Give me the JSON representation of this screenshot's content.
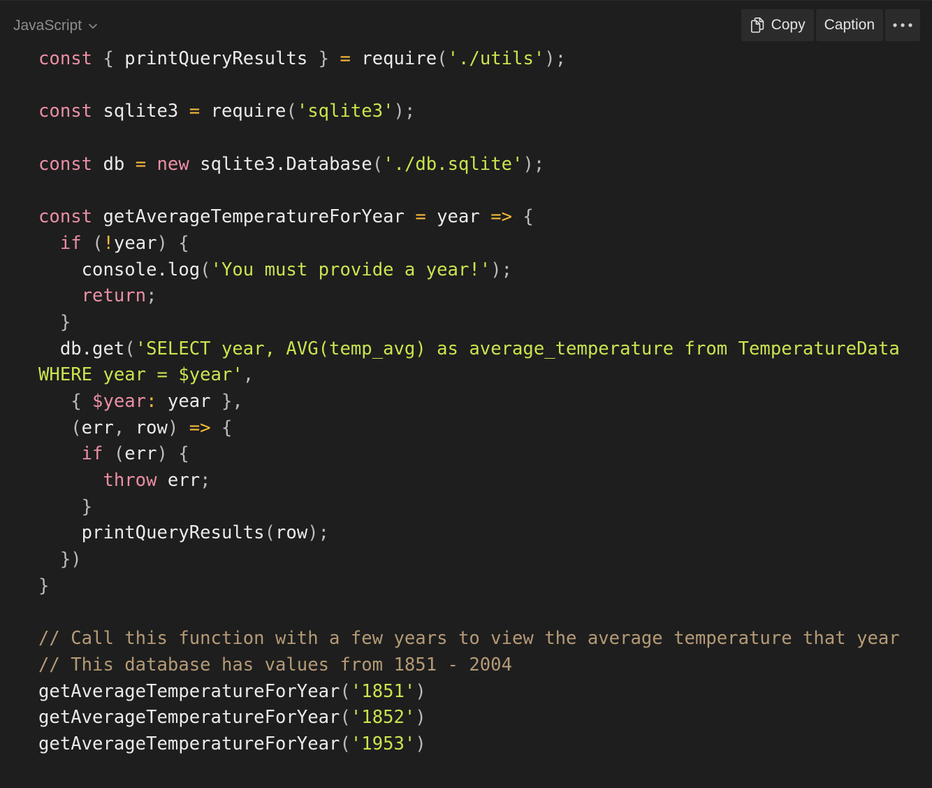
{
  "header": {
    "language": "JavaScript",
    "copy_label": "Copy",
    "caption_label": "Caption"
  },
  "icons": {
    "language_dropdown": "chevron-down-icon",
    "copy": "copy-icon",
    "more": "more-horizontal-icon"
  },
  "colors": {
    "background": "#1e1e1e",
    "keyword": "#ea8fa4",
    "string": "#c9e44f",
    "operator": "#f5b93a",
    "comment": "#b59a76",
    "text": "#eaeaea"
  },
  "code_lines": [
    [
      [
        "kw",
        "const"
      ],
      [
        "pn",
        " { "
      ],
      [
        "tx",
        "printQueryResults"
      ],
      [
        "pn",
        " } "
      ],
      [
        "op",
        "="
      ],
      [
        "tx",
        " require"
      ],
      [
        "pn",
        "("
      ],
      [
        "str",
        "'./utils'"
      ],
      [
        "pn",
        ");"
      ]
    ],
    [],
    [
      [
        "kw",
        "const"
      ],
      [
        "tx",
        " sqlite3 "
      ],
      [
        "op",
        "="
      ],
      [
        "tx",
        " require"
      ],
      [
        "pn",
        "("
      ],
      [
        "str",
        "'sqlite3'"
      ],
      [
        "pn",
        ");"
      ]
    ],
    [],
    [
      [
        "kw",
        "const"
      ],
      [
        "tx",
        " db "
      ],
      [
        "op",
        "="
      ],
      [
        "kw",
        " new"
      ],
      [
        "tx",
        " sqlite3.Database"
      ],
      [
        "pn",
        "("
      ],
      [
        "str",
        "'./db.sqlite'"
      ],
      [
        "pn",
        ");"
      ]
    ],
    [],
    [
      [
        "kw",
        "const"
      ],
      [
        "tx",
        " getAverageTemperatureForYear "
      ],
      [
        "op",
        "="
      ],
      [
        "tx",
        " year "
      ],
      [
        "op",
        "=>"
      ],
      [
        "pn",
        " {"
      ]
    ],
    [
      [
        "tx",
        "  "
      ],
      [
        "kw",
        "if"
      ],
      [
        "pn",
        " ("
      ],
      [
        "op",
        "!"
      ],
      [
        "tx",
        "year"
      ],
      [
        "pn",
        ") {"
      ]
    ],
    [
      [
        "tx",
        "    console.log"
      ],
      [
        "pn",
        "("
      ],
      [
        "str",
        "'You must provide a year!'"
      ],
      [
        "pn",
        ");"
      ]
    ],
    [
      [
        "tx",
        "    "
      ],
      [
        "kw",
        "return"
      ],
      [
        "pn",
        ";"
      ]
    ],
    [
      [
        "pn",
        "  }"
      ]
    ],
    [
      [
        "tx",
        "  db.get"
      ],
      [
        "pn",
        "("
      ],
      [
        "str",
        "'SELECT year, AVG(temp_avg) as average_temperature from TemperatureData"
      ]
    ],
    [
      [
        "str",
        "WHERE year = $year'"
      ],
      [
        "pn",
        ","
      ]
    ],
    [
      [
        "pn",
        "   { "
      ],
      [
        "kw",
        "$year"
      ],
      [
        "op",
        ":"
      ],
      [
        "tx",
        " year "
      ],
      [
        "pn",
        "},"
      ]
    ],
    [
      [
        "pn",
        "   ("
      ],
      [
        "tx",
        "err"
      ],
      [
        "pn",
        ", "
      ],
      [
        "tx",
        "row"
      ],
      [
        "pn",
        ") "
      ],
      [
        "op",
        "=>"
      ],
      [
        "pn",
        " {"
      ]
    ],
    [
      [
        "tx",
        "    "
      ],
      [
        "kw",
        "if"
      ],
      [
        "pn",
        " ("
      ],
      [
        "tx",
        "err"
      ],
      [
        "pn",
        ") {"
      ]
    ],
    [
      [
        "tx",
        "      "
      ],
      [
        "kw",
        "throw"
      ],
      [
        "tx",
        " err"
      ],
      [
        "pn",
        ";"
      ]
    ],
    [
      [
        "pn",
        "    }"
      ]
    ],
    [
      [
        "tx",
        "    printQueryResults"
      ],
      [
        "pn",
        "("
      ],
      [
        "tx",
        "row"
      ],
      [
        "pn",
        ");"
      ]
    ],
    [
      [
        "pn",
        "  })"
      ]
    ],
    [
      [
        "pn",
        "}"
      ]
    ],
    [],
    [
      [
        "cm",
        "// Call this function with a few years to view the average temperature that year"
      ]
    ],
    [
      [
        "cm",
        "// This database has values from 1851 - 2004"
      ]
    ],
    [
      [
        "tx",
        "getAverageTemperatureForYear"
      ],
      [
        "pn",
        "("
      ],
      [
        "str",
        "'1851'"
      ],
      [
        "pn",
        ")"
      ]
    ],
    [
      [
        "tx",
        "getAverageTemperatureForYear"
      ],
      [
        "pn",
        "("
      ],
      [
        "str",
        "'1852'"
      ],
      [
        "pn",
        ")"
      ]
    ],
    [
      [
        "tx",
        "getAverageTemperatureForYear"
      ],
      [
        "pn",
        "("
      ],
      [
        "str",
        "'1953'"
      ],
      [
        "pn",
        ")"
      ]
    ]
  ]
}
